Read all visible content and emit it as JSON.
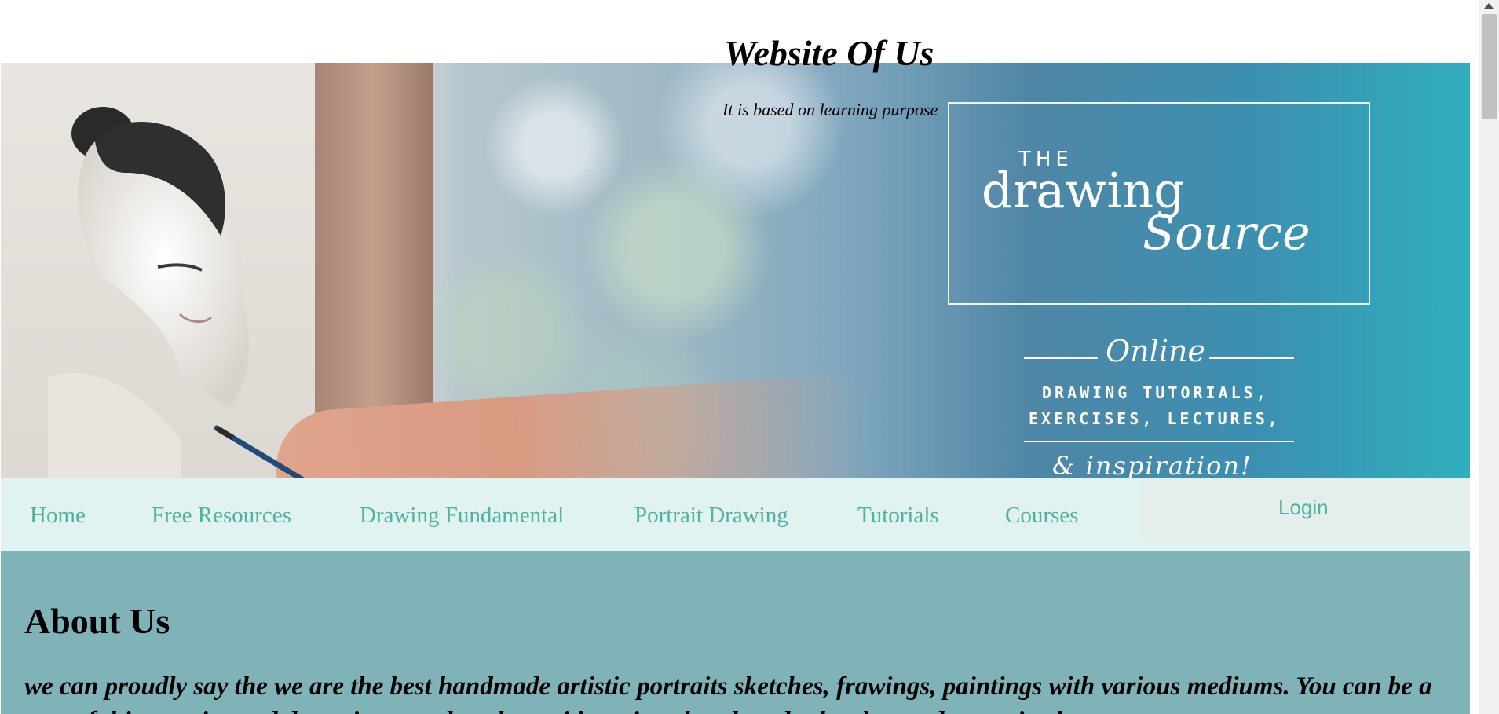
{
  "header": {
    "title": "Website Of Us",
    "tagline": "It is based on learning purpose"
  },
  "hero": {
    "logo_the": "THE",
    "logo_drawing": "drawing",
    "logo_source": "Source",
    "online": "Online",
    "caption_line1": "DRAWING TUTORIALS,",
    "caption_line2": "EXERCISES, LECTURES,",
    "inspiration": "& inspiration!"
  },
  "nav": {
    "items": [
      {
        "label": "Home"
      },
      {
        "label": "Free Resources"
      },
      {
        "label": "Drawing Fundamental"
      },
      {
        "label": "Portrait Drawing"
      },
      {
        "label": "Tutorials"
      },
      {
        "label": "Courses"
      }
    ],
    "login": "Login"
  },
  "about": {
    "heading": "About Us",
    "text": "we can proudly say the we are the best handmade artistic portraits sketches, frawings, paintings with various mediums. You can be a part of this creative and deserving... and explore with various hand made sketches and portraits that"
  },
  "colors": {
    "nav_bg": "#e0f3f1",
    "nav_link": "#4fb1a0",
    "about_bg": "#80b3b8",
    "hero_teal": "#30aebd"
  }
}
